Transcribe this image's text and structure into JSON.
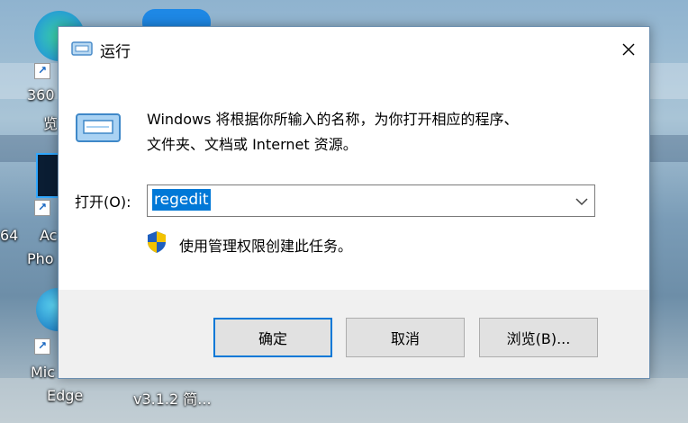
{
  "desktop": {
    "icons": [
      {
        "label_lines": [
          "360",
          "览"
        ],
        "shortcut": "↗"
      },
      {
        "label_lines": [
          "64",
          "Ac",
          "Pho"
        ],
        "shortcut": "↗"
      },
      {
        "label_lines": [
          "Mic",
          "Edge"
        ],
        "shortcut": "↗"
      },
      {
        "label_lines": [
          "v3.1.2 简..."
        ]
      }
    ]
  },
  "dialog": {
    "title": "运行",
    "description_line1": "Windows 将根据你所输入的名称，为你打开相应的程序、",
    "description_line2": "文件夹、文档或 Internet 资源。",
    "open_label": "打开(O):",
    "input_value": "regedit",
    "admin_note": "使用管理权限创建此任务。",
    "buttons": {
      "ok": "确定",
      "cancel": "取消",
      "browse": "浏览(B)..."
    }
  },
  "colors": {
    "accent": "#0078d7",
    "dialog_bg": "#f0f0f0"
  }
}
